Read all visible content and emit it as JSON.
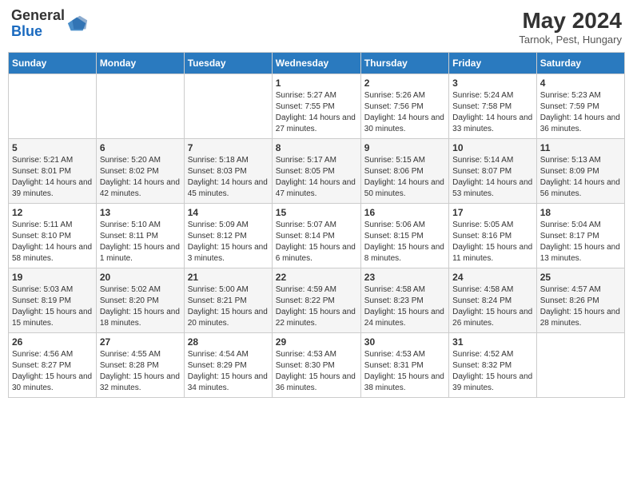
{
  "header": {
    "logo_line1": "General",
    "logo_line2": "Blue",
    "month_year": "May 2024",
    "location": "Tarnok, Pest, Hungary"
  },
  "days_of_week": [
    "Sunday",
    "Monday",
    "Tuesday",
    "Wednesday",
    "Thursday",
    "Friday",
    "Saturday"
  ],
  "weeks": [
    [
      {
        "day": "",
        "info": ""
      },
      {
        "day": "",
        "info": ""
      },
      {
        "day": "",
        "info": ""
      },
      {
        "day": "1",
        "info": "Sunrise: 5:27 AM\nSunset: 7:55 PM\nDaylight: 14 hours and 27 minutes."
      },
      {
        "day": "2",
        "info": "Sunrise: 5:26 AM\nSunset: 7:56 PM\nDaylight: 14 hours and 30 minutes."
      },
      {
        "day": "3",
        "info": "Sunrise: 5:24 AM\nSunset: 7:58 PM\nDaylight: 14 hours and 33 minutes."
      },
      {
        "day": "4",
        "info": "Sunrise: 5:23 AM\nSunset: 7:59 PM\nDaylight: 14 hours and 36 minutes."
      }
    ],
    [
      {
        "day": "5",
        "info": "Sunrise: 5:21 AM\nSunset: 8:01 PM\nDaylight: 14 hours and 39 minutes."
      },
      {
        "day": "6",
        "info": "Sunrise: 5:20 AM\nSunset: 8:02 PM\nDaylight: 14 hours and 42 minutes."
      },
      {
        "day": "7",
        "info": "Sunrise: 5:18 AM\nSunset: 8:03 PM\nDaylight: 14 hours and 45 minutes."
      },
      {
        "day": "8",
        "info": "Sunrise: 5:17 AM\nSunset: 8:05 PM\nDaylight: 14 hours and 47 minutes."
      },
      {
        "day": "9",
        "info": "Sunrise: 5:15 AM\nSunset: 8:06 PM\nDaylight: 14 hours and 50 minutes."
      },
      {
        "day": "10",
        "info": "Sunrise: 5:14 AM\nSunset: 8:07 PM\nDaylight: 14 hours and 53 minutes."
      },
      {
        "day": "11",
        "info": "Sunrise: 5:13 AM\nSunset: 8:09 PM\nDaylight: 14 hours and 56 minutes."
      }
    ],
    [
      {
        "day": "12",
        "info": "Sunrise: 5:11 AM\nSunset: 8:10 PM\nDaylight: 14 hours and 58 minutes."
      },
      {
        "day": "13",
        "info": "Sunrise: 5:10 AM\nSunset: 8:11 PM\nDaylight: 15 hours and 1 minute."
      },
      {
        "day": "14",
        "info": "Sunrise: 5:09 AM\nSunset: 8:12 PM\nDaylight: 15 hours and 3 minutes."
      },
      {
        "day": "15",
        "info": "Sunrise: 5:07 AM\nSunset: 8:14 PM\nDaylight: 15 hours and 6 minutes."
      },
      {
        "day": "16",
        "info": "Sunrise: 5:06 AM\nSunset: 8:15 PM\nDaylight: 15 hours and 8 minutes."
      },
      {
        "day": "17",
        "info": "Sunrise: 5:05 AM\nSunset: 8:16 PM\nDaylight: 15 hours and 11 minutes."
      },
      {
        "day": "18",
        "info": "Sunrise: 5:04 AM\nSunset: 8:17 PM\nDaylight: 15 hours and 13 minutes."
      }
    ],
    [
      {
        "day": "19",
        "info": "Sunrise: 5:03 AM\nSunset: 8:19 PM\nDaylight: 15 hours and 15 minutes."
      },
      {
        "day": "20",
        "info": "Sunrise: 5:02 AM\nSunset: 8:20 PM\nDaylight: 15 hours and 18 minutes."
      },
      {
        "day": "21",
        "info": "Sunrise: 5:00 AM\nSunset: 8:21 PM\nDaylight: 15 hours and 20 minutes."
      },
      {
        "day": "22",
        "info": "Sunrise: 4:59 AM\nSunset: 8:22 PM\nDaylight: 15 hours and 22 minutes."
      },
      {
        "day": "23",
        "info": "Sunrise: 4:58 AM\nSunset: 8:23 PM\nDaylight: 15 hours and 24 minutes."
      },
      {
        "day": "24",
        "info": "Sunrise: 4:58 AM\nSunset: 8:24 PM\nDaylight: 15 hours and 26 minutes."
      },
      {
        "day": "25",
        "info": "Sunrise: 4:57 AM\nSunset: 8:26 PM\nDaylight: 15 hours and 28 minutes."
      }
    ],
    [
      {
        "day": "26",
        "info": "Sunrise: 4:56 AM\nSunset: 8:27 PM\nDaylight: 15 hours and 30 minutes."
      },
      {
        "day": "27",
        "info": "Sunrise: 4:55 AM\nSunset: 8:28 PM\nDaylight: 15 hours and 32 minutes."
      },
      {
        "day": "28",
        "info": "Sunrise: 4:54 AM\nSunset: 8:29 PM\nDaylight: 15 hours and 34 minutes."
      },
      {
        "day": "29",
        "info": "Sunrise: 4:53 AM\nSunset: 8:30 PM\nDaylight: 15 hours and 36 minutes."
      },
      {
        "day": "30",
        "info": "Sunrise: 4:53 AM\nSunset: 8:31 PM\nDaylight: 15 hours and 38 minutes."
      },
      {
        "day": "31",
        "info": "Sunrise: 4:52 AM\nSunset: 8:32 PM\nDaylight: 15 hours and 39 minutes."
      },
      {
        "day": "",
        "info": ""
      }
    ]
  ]
}
